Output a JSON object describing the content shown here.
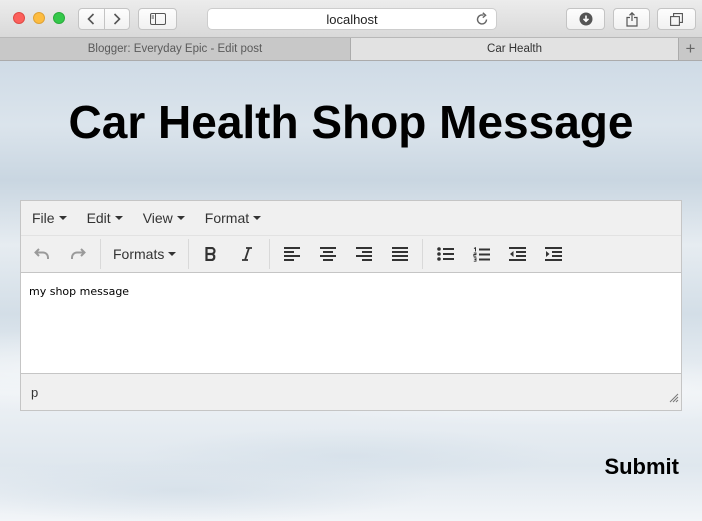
{
  "browser": {
    "address": "localhost",
    "tabs": [
      {
        "label": "Blogger: Everyday Epic - Edit post"
      },
      {
        "label": "Car Health"
      }
    ],
    "new_tab_label": "+"
  },
  "page": {
    "title": "Car Health Shop Message",
    "submit_label": "Submit"
  },
  "editor": {
    "menus": [
      {
        "label": "File"
      },
      {
        "label": "Edit"
      },
      {
        "label": "View"
      },
      {
        "label": "Format"
      }
    ],
    "formats_label": "Formats",
    "content": "my shop message",
    "path": "p",
    "icons": [
      "undo-icon",
      "redo-icon",
      "bold-icon",
      "italic-icon",
      "align-left-icon",
      "align-center-icon",
      "align-right-icon",
      "align-justify-icon",
      "bullet-list-icon",
      "numbered-list-icon",
      "outdent-icon",
      "indent-icon"
    ]
  }
}
